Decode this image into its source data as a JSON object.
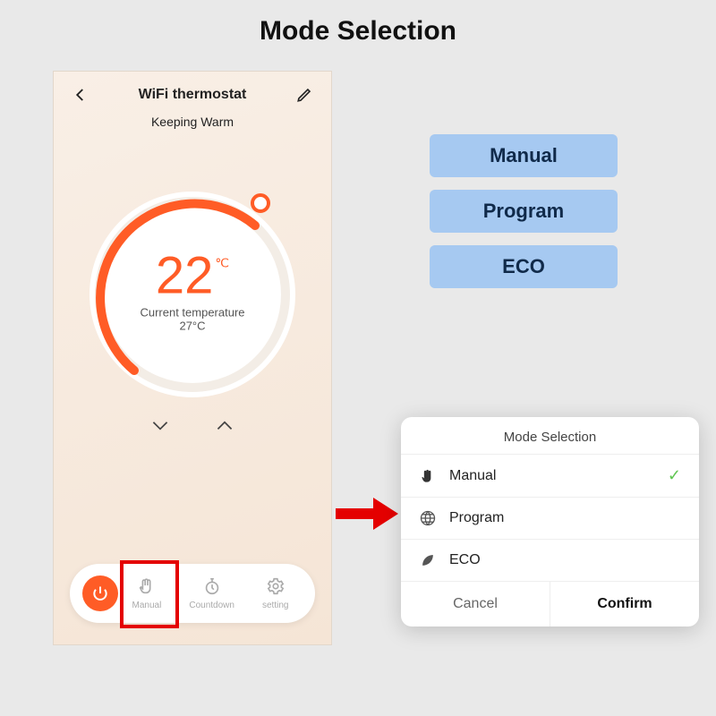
{
  "page_title": "Mode Selection",
  "phone": {
    "title": "WiFi thermostat",
    "status": "Keeping Warm",
    "temp_value": "22",
    "temp_unit": "℃",
    "current_temp": "Current temperature 27°C",
    "bottom": {
      "manual": "Manual",
      "countdown": "Countdown",
      "setting": "setting"
    }
  },
  "mode_buttons": {
    "manual": "Manual",
    "program": "Program",
    "eco": "ECO"
  },
  "sheet": {
    "title": "Mode Selection",
    "rows": {
      "manual": "Manual",
      "program": "Program",
      "eco": "ECO"
    },
    "cancel": "Cancel",
    "confirm": "Confirm"
  }
}
